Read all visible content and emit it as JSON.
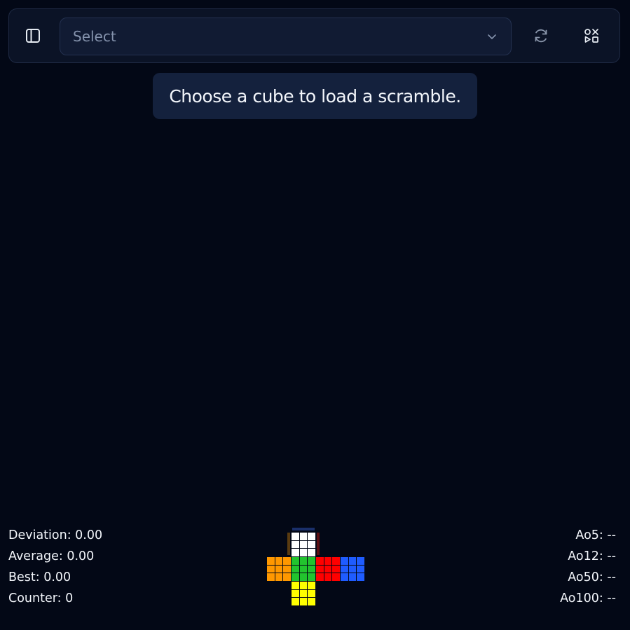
{
  "toolbar": {
    "select": {
      "value": "Select"
    }
  },
  "message": {
    "text": "Choose a cube to load a scramble."
  },
  "stats_left": [
    {
      "label": "Deviation",
      "value": "0.00",
      "text": "Deviation: 0.00"
    },
    {
      "label": "Average",
      "value": "0.00",
      "text": "Average: 0.00"
    },
    {
      "label": "Best",
      "value": "0.00",
      "text": "Best: 0.00"
    },
    {
      "label": "Counter",
      "value": "0",
      "text": "Counter: 0"
    }
  ],
  "stats_right": [
    {
      "label": "Ao5",
      "value": "--",
      "text": "Ao5: --"
    },
    {
      "label": "Ao12",
      "value": "--",
      "text": "Ao12: --"
    },
    {
      "label": "Ao50",
      "value": "--",
      "text": "Ao50: --"
    },
    {
      "label": "Ao100",
      "value": "--",
      "text": "Ao100: --"
    }
  ],
  "icons": {
    "sidebar": "sidebar-toggle-icon",
    "refresh": "refresh-icon",
    "mode": "shapes-icon",
    "chevron": "chevron-down-icon"
  },
  "cube_colors": {
    "up": "#ffffff",
    "left": "#ff9800",
    "front": "#22c32e",
    "right": "#ff0000",
    "back": "#1f5cff",
    "down": "#ffff00"
  }
}
